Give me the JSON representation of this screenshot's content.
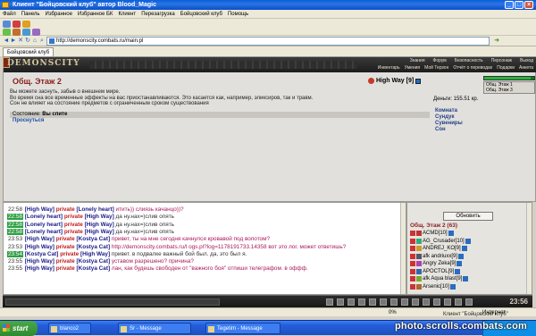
{
  "window": {
    "title": "Клиент \"Бойцовский клуб\" автор Blood_Magic"
  },
  "menu": [
    "Файл",
    "Панель",
    "Избранное",
    "Избранное БК",
    "Клиент",
    "Перезагрузка",
    "Бойцовский клуб",
    "Помощь"
  ],
  "address": {
    "url": "http://demonscity.combats.ru/main.pl"
  },
  "favtab": "Бойцовский клуб",
  "game": {
    "logo": "DEMONSCITY",
    "topnav": [
      "Знания",
      "Форум",
      "Безопасность",
      "Персонаж",
      "Выход"
    ],
    "subnav": [
      "Инвентарь",
      "Умения",
      "Мой Терзон",
      "Отчёт о переводах",
      "Подарки",
      "Анкета"
    ],
    "room_title": "Общ. Этаж 2",
    "room_desc": [
      "Вы можете заснуть, забыв о внешнем мире.",
      "Во время сна все временные эффекты на вас приостанавливаются. Это касается как, например, эликсиров, так и травм.",
      "Сон не влияет на состояние предметов с ограниченным сроком существования"
    ],
    "user": {
      "name": "High Way",
      "level": "[9]"
    },
    "hp_fraction": 0.92,
    "floor_box": [
      "Общ. Этаж 1",
      "Общ. Этаж 3"
    ],
    "money": "Деньги: 155.51 кр.",
    "links": [
      "Комната",
      "Сундук",
      "Сувениры",
      "Сон"
    ],
    "status_label": "Состояние:",
    "status_value": "Вы спите",
    "wake": "Проснуться"
  },
  "chat": [
    {
      "time": "22:58",
      "from": "[High Way]",
      "priv": "private",
      "to": "[Lonely heart]",
      "text": "итить)) слиязь качанцо))?",
      "green": false,
      "cls": "pink"
    },
    {
      "time": "22:58",
      "from": "[Lonely heart]",
      "priv": "private",
      "to": "[High Way]",
      "text": "да ну.нах=)слив опять",
      "green": true,
      "cls": "dark"
    },
    {
      "time": "22:58",
      "from": "[Lonely heart]",
      "priv": "private",
      "to": "[High Way]",
      "text": "да ну.нах=)слив опять",
      "green": true,
      "cls": "dark"
    },
    {
      "time": "22:58",
      "from": "[Lonely heart]",
      "priv": "private",
      "to": "[High Way]",
      "text": "да ну.нах=)слив опять",
      "green": true,
      "cls": "dark"
    },
    {
      "time": "23:53",
      "from": "[High Way]",
      "priv": "private",
      "to": "[Kostya Cat]",
      "text": "привет, ты на мне сегодня качнулся кровавой под вопотом?",
      "green": false,
      "cls": "pink"
    },
    {
      "time": "23:53",
      "from": "[High Way]",
      "priv": "private",
      "to": "[Kostya Cat]",
      "text": "http://demonscity.combats.ru/l ogs.pl?log=1178191733.14358 вот это лог. может ответишь?",
      "green": false,
      "cls": "pink"
    },
    {
      "time": "23:54",
      "from": "[Kostya Cat]",
      "priv": "private",
      "to": "[High Way]",
      "text": "привет. в подвалке важный бой был. да, это был я.",
      "green": true,
      "cls": "dark"
    },
    {
      "time": "23:55",
      "from": "[High Way]",
      "priv": "private",
      "to": "[Kostya Cat]",
      "text": "уставом разрешено? причина?",
      "green": false,
      "cls": "pink"
    },
    {
      "time": "23:55",
      "from": "[High Way]",
      "priv": "private",
      "to": "[Kostya Cat]",
      "text": "лан, как будешь свободен от \"важного боя\" отпиши телеграфом. в оффф.",
      "green": false,
      "cls": "pink"
    }
  ],
  "online": {
    "refresh": "Обновить",
    "title": "Общ. Этаж 2 (63)",
    "users": [
      "ACMD[10]",
      "AG_Crusader[10]",
      "ANDREJ_KO[9]",
      "afk andriuxx[9]",
      "Angry Zeka[9]",
      "APOCTOL[9]",
      "afk Aqua blast[9]",
      "Arsenic[10]"
    ]
  },
  "clock": "23:56",
  "iestatus": {
    "percent": "0%",
    "zone": "Интернет"
  },
  "taskbar": {
    "start": "start",
    "tasks": [
      "blanco2",
      "Sr - Message",
      "Tegetim - Message"
    ],
    "tray_title": "Клиент \"Бойцовский клуб\""
  },
  "watermark": "photo.scrolls.combats.com"
}
